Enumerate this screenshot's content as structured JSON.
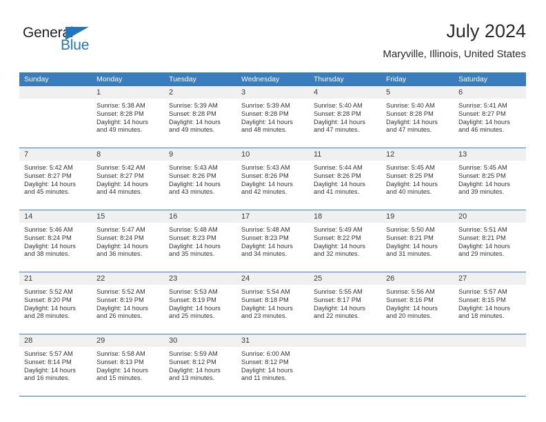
{
  "brand": {
    "name_part1": "General",
    "name_part2": "Blue",
    "triangle_icon": "triangle-icon",
    "color_dark": "#231f20",
    "color_blue": "#2276bd"
  },
  "header": {
    "title": "July 2024",
    "subtitle": "Maryville, Illinois, United States"
  },
  "calendar": {
    "header_bg": "#3a7dbd",
    "numband_bg": "#f0f0f0",
    "day_names": [
      "Sunday",
      "Monday",
      "Tuesday",
      "Wednesday",
      "Thursday",
      "Friday",
      "Saturday"
    ],
    "weeks": [
      [
        {
          "day": "",
          "empty": true,
          "sunrise": "",
          "sunset": "",
          "daylight_line1": "",
          "daylight_line2": ""
        },
        {
          "day": "1",
          "sunrise": "Sunrise: 5:38 AM",
          "sunset": "Sunset: 8:28 PM",
          "daylight_line1": "Daylight: 14 hours",
          "daylight_line2": "and 49 minutes."
        },
        {
          "day": "2",
          "sunrise": "Sunrise: 5:39 AM",
          "sunset": "Sunset: 8:28 PM",
          "daylight_line1": "Daylight: 14 hours",
          "daylight_line2": "and 49 minutes."
        },
        {
          "day": "3",
          "sunrise": "Sunrise: 5:39 AM",
          "sunset": "Sunset: 8:28 PM",
          "daylight_line1": "Daylight: 14 hours",
          "daylight_line2": "and 48 minutes."
        },
        {
          "day": "4",
          "sunrise": "Sunrise: 5:40 AM",
          "sunset": "Sunset: 8:28 PM",
          "daylight_line1": "Daylight: 14 hours",
          "daylight_line2": "and 47 minutes."
        },
        {
          "day": "5",
          "sunrise": "Sunrise: 5:40 AM",
          "sunset": "Sunset: 8:28 PM",
          "daylight_line1": "Daylight: 14 hours",
          "daylight_line2": "and 47 minutes."
        },
        {
          "day": "6",
          "sunrise": "Sunrise: 5:41 AM",
          "sunset": "Sunset: 8:27 PM",
          "daylight_line1": "Daylight: 14 hours",
          "daylight_line2": "and 46 minutes."
        }
      ],
      [
        {
          "day": "7",
          "sunrise": "Sunrise: 5:42 AM",
          "sunset": "Sunset: 8:27 PM",
          "daylight_line1": "Daylight: 14 hours",
          "daylight_line2": "and 45 minutes."
        },
        {
          "day": "8",
          "sunrise": "Sunrise: 5:42 AM",
          "sunset": "Sunset: 8:27 PM",
          "daylight_line1": "Daylight: 14 hours",
          "daylight_line2": "and 44 minutes."
        },
        {
          "day": "9",
          "sunrise": "Sunrise: 5:43 AM",
          "sunset": "Sunset: 8:26 PM",
          "daylight_line1": "Daylight: 14 hours",
          "daylight_line2": "and 43 minutes."
        },
        {
          "day": "10",
          "sunrise": "Sunrise: 5:43 AM",
          "sunset": "Sunset: 8:26 PM",
          "daylight_line1": "Daylight: 14 hours",
          "daylight_line2": "and 42 minutes."
        },
        {
          "day": "11",
          "sunrise": "Sunrise: 5:44 AM",
          "sunset": "Sunset: 8:26 PM",
          "daylight_line1": "Daylight: 14 hours",
          "daylight_line2": "and 41 minutes."
        },
        {
          "day": "12",
          "sunrise": "Sunrise: 5:45 AM",
          "sunset": "Sunset: 8:25 PM",
          "daylight_line1": "Daylight: 14 hours",
          "daylight_line2": "and 40 minutes."
        },
        {
          "day": "13",
          "sunrise": "Sunrise: 5:45 AM",
          "sunset": "Sunset: 8:25 PM",
          "daylight_line1": "Daylight: 14 hours",
          "daylight_line2": "and 39 minutes."
        }
      ],
      [
        {
          "day": "14",
          "sunrise": "Sunrise: 5:46 AM",
          "sunset": "Sunset: 8:24 PM",
          "daylight_line1": "Daylight: 14 hours",
          "daylight_line2": "and 38 minutes."
        },
        {
          "day": "15",
          "sunrise": "Sunrise: 5:47 AM",
          "sunset": "Sunset: 8:24 PM",
          "daylight_line1": "Daylight: 14 hours",
          "daylight_line2": "and 36 minutes."
        },
        {
          "day": "16",
          "sunrise": "Sunrise: 5:48 AM",
          "sunset": "Sunset: 8:23 PM",
          "daylight_line1": "Daylight: 14 hours",
          "daylight_line2": "and 35 minutes."
        },
        {
          "day": "17",
          "sunrise": "Sunrise: 5:48 AM",
          "sunset": "Sunset: 8:23 PM",
          "daylight_line1": "Daylight: 14 hours",
          "daylight_line2": "and 34 minutes."
        },
        {
          "day": "18",
          "sunrise": "Sunrise: 5:49 AM",
          "sunset": "Sunset: 8:22 PM",
          "daylight_line1": "Daylight: 14 hours",
          "daylight_line2": "and 32 minutes."
        },
        {
          "day": "19",
          "sunrise": "Sunrise: 5:50 AM",
          "sunset": "Sunset: 8:21 PM",
          "daylight_line1": "Daylight: 14 hours",
          "daylight_line2": "and 31 minutes."
        },
        {
          "day": "20",
          "sunrise": "Sunrise: 5:51 AM",
          "sunset": "Sunset: 8:21 PM",
          "daylight_line1": "Daylight: 14 hours",
          "daylight_line2": "and 29 minutes."
        }
      ],
      [
        {
          "day": "21",
          "sunrise": "Sunrise: 5:52 AM",
          "sunset": "Sunset: 8:20 PM",
          "daylight_line1": "Daylight: 14 hours",
          "daylight_line2": "and 28 minutes."
        },
        {
          "day": "22",
          "sunrise": "Sunrise: 5:52 AM",
          "sunset": "Sunset: 8:19 PM",
          "daylight_line1": "Daylight: 14 hours",
          "daylight_line2": "and 26 minutes."
        },
        {
          "day": "23",
          "sunrise": "Sunrise: 5:53 AM",
          "sunset": "Sunset: 8:19 PM",
          "daylight_line1": "Daylight: 14 hours",
          "daylight_line2": "and 25 minutes."
        },
        {
          "day": "24",
          "sunrise": "Sunrise: 5:54 AM",
          "sunset": "Sunset: 8:18 PM",
          "daylight_line1": "Daylight: 14 hours",
          "daylight_line2": "and 23 minutes."
        },
        {
          "day": "25",
          "sunrise": "Sunrise: 5:55 AM",
          "sunset": "Sunset: 8:17 PM",
          "daylight_line1": "Daylight: 14 hours",
          "daylight_line2": "and 22 minutes."
        },
        {
          "day": "26",
          "sunrise": "Sunrise: 5:56 AM",
          "sunset": "Sunset: 8:16 PM",
          "daylight_line1": "Daylight: 14 hours",
          "daylight_line2": "and 20 minutes."
        },
        {
          "day": "27",
          "sunrise": "Sunrise: 5:57 AM",
          "sunset": "Sunset: 8:15 PM",
          "daylight_line1": "Daylight: 14 hours",
          "daylight_line2": "and 18 minutes."
        }
      ],
      [
        {
          "day": "28",
          "sunrise": "Sunrise: 5:57 AM",
          "sunset": "Sunset: 8:14 PM",
          "daylight_line1": "Daylight: 14 hours",
          "daylight_line2": "and 16 minutes."
        },
        {
          "day": "29",
          "sunrise": "Sunrise: 5:58 AM",
          "sunset": "Sunset: 8:13 PM",
          "daylight_line1": "Daylight: 14 hours",
          "daylight_line2": "and 15 minutes."
        },
        {
          "day": "30",
          "sunrise": "Sunrise: 5:59 AM",
          "sunset": "Sunset: 8:12 PM",
          "daylight_line1": "Daylight: 14 hours",
          "daylight_line2": "and 13 minutes."
        },
        {
          "day": "31",
          "sunrise": "Sunrise: 6:00 AM",
          "sunset": "Sunset: 8:12 PM",
          "daylight_line1": "Daylight: 14 hours",
          "daylight_line2": "and 11 minutes."
        },
        {
          "day": "",
          "empty": true,
          "sunrise": "",
          "sunset": "",
          "daylight_line1": "",
          "daylight_line2": ""
        },
        {
          "day": "",
          "empty": true,
          "sunrise": "",
          "sunset": "",
          "daylight_line1": "",
          "daylight_line2": ""
        },
        {
          "day": "",
          "empty": true,
          "sunrise": "",
          "sunset": "",
          "daylight_line1": "",
          "daylight_line2": ""
        }
      ]
    ]
  }
}
